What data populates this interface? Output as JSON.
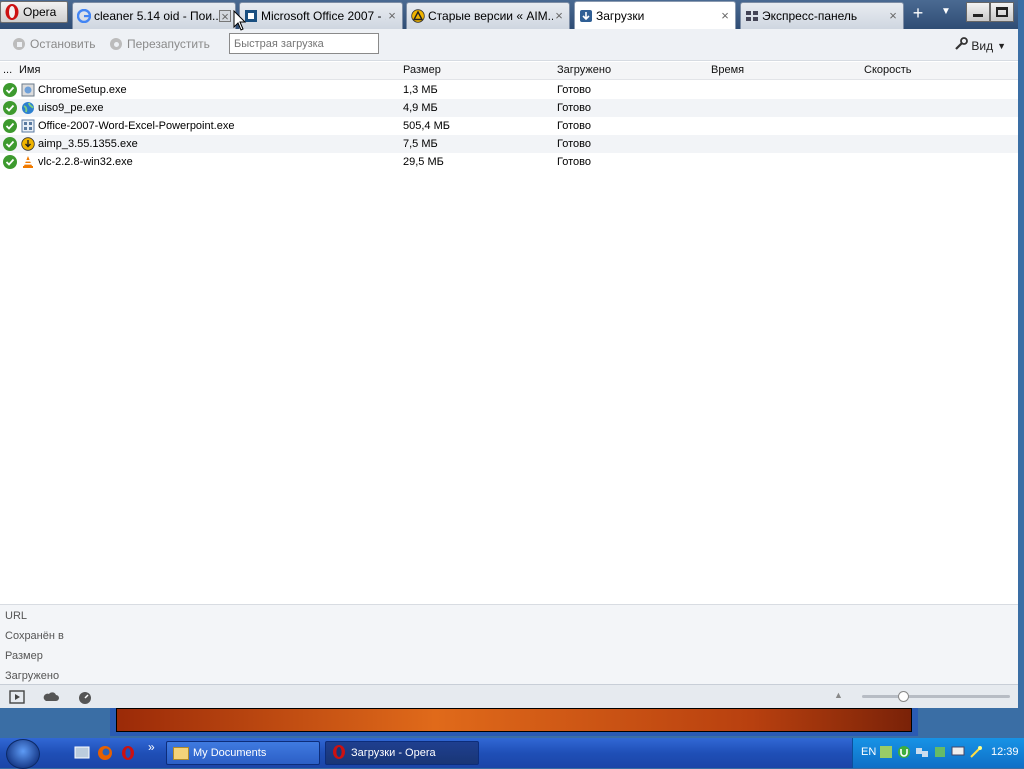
{
  "browser": {
    "opera_menu_label": "Opera",
    "tabs": [
      {
        "label": "cleaner 5.14 oid - Пои...",
        "icon": "google-icon",
        "active": false
      },
      {
        "label": "Microsoft Office 2007 - ...",
        "icon": "site-icon",
        "active": false
      },
      {
        "label": "Старые версии « AIM...",
        "icon": "aimp-icon",
        "active": false
      },
      {
        "label": "Загрузки",
        "icon": "download-icon",
        "active": true
      },
      {
        "label": "Экспресс-панель",
        "icon": "speed-dial-icon",
        "active": false
      }
    ]
  },
  "toolbar": {
    "stop_label": "Остановить",
    "restart_label": "Перезапустить",
    "quick_placeholder": "Быстрая загрузка",
    "view_label": "Вид"
  },
  "table": {
    "columns": {
      "dots": "...",
      "name": "Имя",
      "size": "Размер",
      "loaded": "Загружено",
      "time": "Время",
      "speed": "Скорость"
    },
    "rows": [
      {
        "name": "ChromeSetup.exe",
        "size": "1,3 МБ",
        "loaded": "Готово",
        "icon": "installer-icon"
      },
      {
        "name": "uiso9_pe.exe",
        "size": "4,9 МБ",
        "loaded": "Готово",
        "icon": "globe-icon"
      },
      {
        "name": "Office-2007-Word-Excel-Powerpoint.exe",
        "size": "505,4 МБ",
        "loaded": "Готово",
        "icon": "office-icon"
      },
      {
        "name": "aimp_3.55.1355.exe",
        "size": "7,5 МБ",
        "loaded": "Готово",
        "icon": "aimp-icon"
      },
      {
        "name": "vlc-2.2.8-win32.exe",
        "size": "29,5 МБ",
        "loaded": "Готово",
        "icon": "vlc-cone-icon"
      }
    ]
  },
  "details": {
    "url_label": "URL",
    "saved_label": "Сохранён в",
    "size_label": "Размер",
    "loaded_label": "Загружено"
  },
  "taskbar": {
    "items": [
      {
        "label": "My Documents"
      },
      {
        "label": "Загрузки - Opera"
      }
    ],
    "quicklaunch_more": "»",
    "lang": "EN",
    "clock": "12:39"
  }
}
